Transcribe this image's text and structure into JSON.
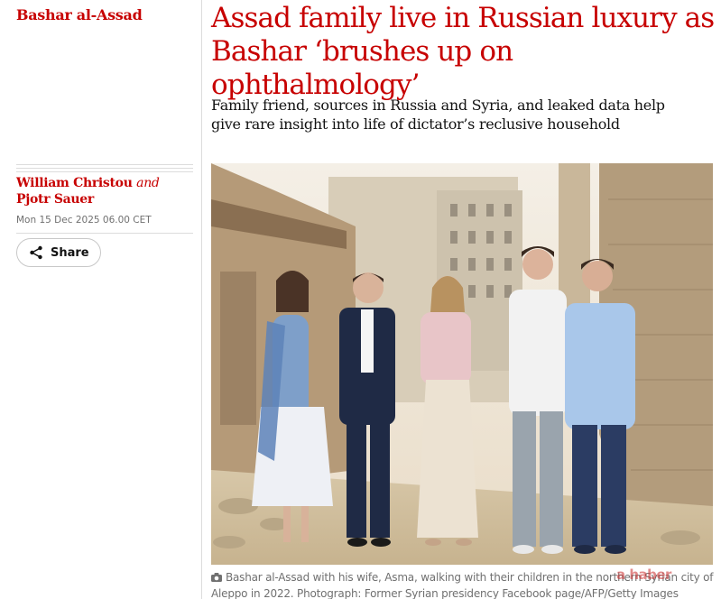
{
  "kicker": "Bashar al-Assad",
  "headline": "Assad family live in Russian luxury as Bashar ‘brushes up on ophthalmology’",
  "standfirst": "Family friend, sources in Russia and Syria, and leaked data help give rare insight into life of dictator’s reclusive household",
  "byline": {
    "author1": "William Christou",
    "conjunction": "and",
    "author2": "Pjotr Sauer"
  },
  "dateline": "Mon 15 Dec 2025 06.00 CET",
  "share": {
    "label": "Share",
    "icon": "share-icon"
  },
  "image": {
    "caption": "Bashar al-Assad with his wife, Asma, walking with their children in the northern Syrian city of Aleppo in 2022. Photograph: Former Syrian presidency Facebook page/AFP/Getty Images",
    "caption_line1": "Bashar al-Assad with his wife, Asma, walking with their children in the northern Syrian city of",
    "caption_line2": "Aleppo in 2022. Photograph: Former Syrian presidency Facebook page/AFP/Getty Images",
    "caption_icon": "camera-icon"
  },
  "watermark": "a haber",
  "colors": {
    "accent": "#c70000",
    "text": "#121212",
    "muted": "#707070",
    "rule": "#dcdcdc"
  }
}
